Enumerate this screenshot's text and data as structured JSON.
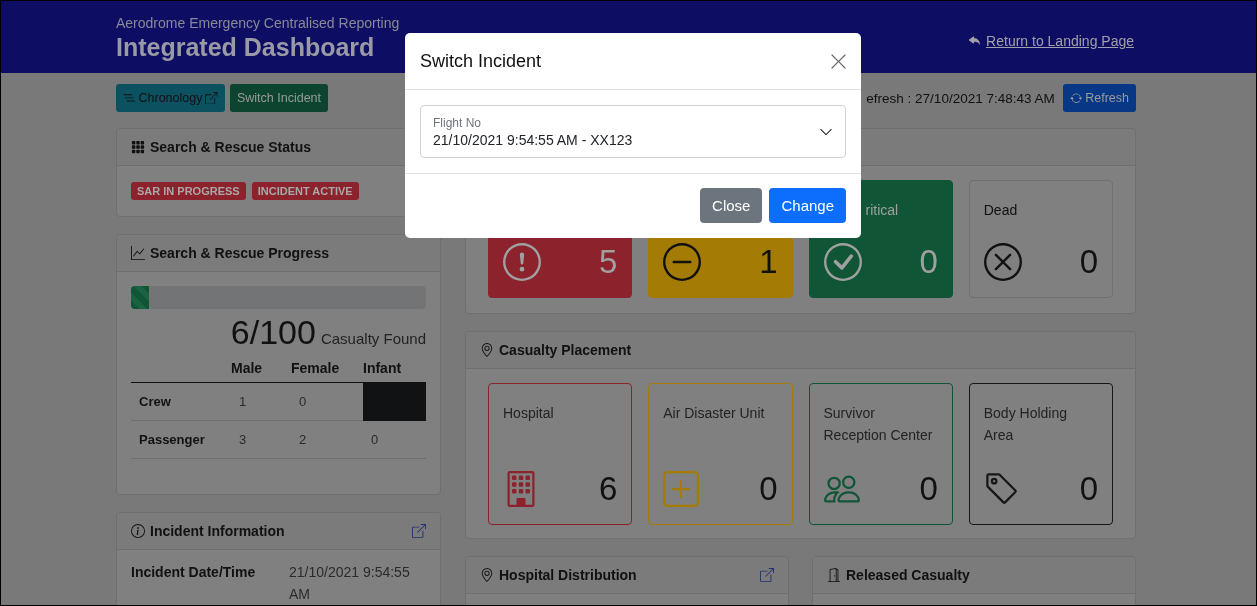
{
  "header": {
    "subtitle": "Aerodrome Emergency Centralised Reporting",
    "title": "Integrated Dashboard",
    "return_link": "Return to Landing Page"
  },
  "toolbar": {
    "chronology_button": "Chronology",
    "switch_button": "Switch Incident",
    "last_refresh": "efresh : 27/10/2021 7:48:43 AM",
    "refresh_button": "Refresh"
  },
  "sar_status": {
    "title": "Search & Rescue Status",
    "badges": [
      "SAR IN PROGRESS",
      "INCIDENT ACTIVE"
    ]
  },
  "sar_progress": {
    "title": "Search & Rescue Progress",
    "level": 0.06,
    "found": "6/100",
    "found_label": "Casualty Found",
    "columns": [
      "Male",
      "Female",
      "Infant"
    ],
    "rows": [
      {
        "label": "Crew",
        "cells": [
          {
            "kind": "text",
            "text": "1"
          },
          {
            "kind": "text",
            "text": "0"
          },
          {
            "kind": "blocked"
          }
        ]
      },
      {
        "label": "Passenger",
        "cells": [
          {
            "kind": "text",
            "text": "3"
          },
          {
            "kind": "text",
            "text": "2"
          },
          {
            "kind": "text",
            "text": "0"
          }
        ]
      }
    ]
  },
  "incident_info": {
    "title": "Incident Information",
    "fields": [
      {
        "label": "Incident Date/Time",
        "value": "21/10/2021 9:54:55 AM"
      }
    ]
  },
  "status_cards": [
    {
      "kind": "exclamation",
      "count": "5",
      "color": "#8c222c"
    },
    {
      "kind": "dash",
      "count": "1",
      "color": "#a37b05"
    },
    {
      "kind": "check",
      "label": "ritical",
      "count": "0",
      "color": "#105636"
    },
    {
      "kind": "cross",
      "label": "Dead",
      "count": "0",
      "color": "#808080"
    }
  ],
  "placement": {
    "title": "Casualty Placement",
    "cards": [
      {
        "kind": "building",
        "label": "Hospital",
        "count": "6",
        "color": "#8c222c"
      },
      {
        "kind": "plus",
        "label": "Air Disaster Unit",
        "count": "0",
        "color": "#a37b05"
      },
      {
        "kind": "people",
        "label": "Survivor Reception Center",
        "count": "0",
        "color": "#105636"
      },
      {
        "kind": "tag",
        "label": "Body Holding Area",
        "count": "0",
        "color": "#151719"
      }
    ]
  },
  "hospital_distribution": {
    "title": "Hospital Distribution"
  },
  "released_casualty": {
    "title": "Released Casualty"
  },
  "modal": {
    "title": "Switch Incident",
    "select": {
      "label": "Flight No",
      "value": "21/10/2021 9:54:55 AM - XX123"
    },
    "buttons": [
      {
        "kind": "secondary",
        "label": "Close"
      },
      {
        "kind": "primary",
        "label": "Change"
      }
    ]
  }
}
